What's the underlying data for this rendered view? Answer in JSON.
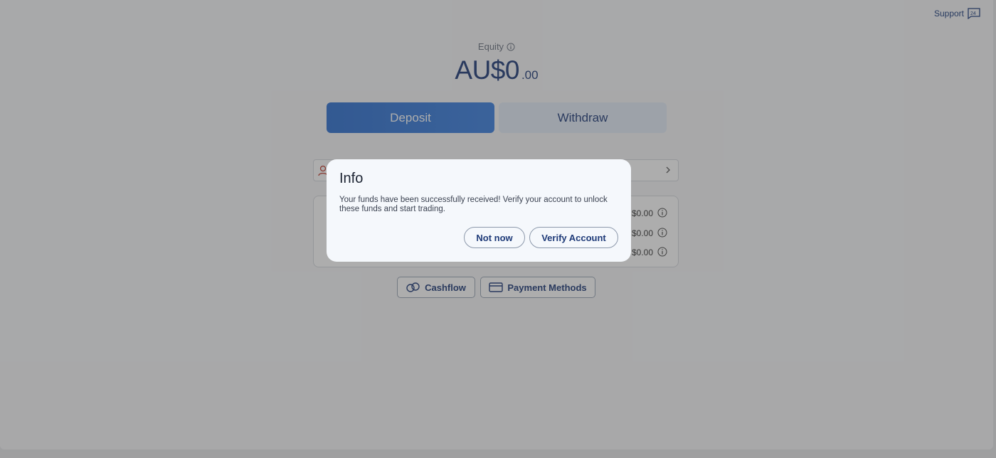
{
  "header": {
    "support_label": "Support",
    "support_icon": "chat-24-icon"
  },
  "equity": {
    "label": "Equity",
    "main": "AU$0",
    "decimals": ".00"
  },
  "actions": {
    "deposit_label": "Deposit",
    "withdraw_label": "Withdraw"
  },
  "balances": [
    {
      "value": "$0.00"
    },
    {
      "value": "$0.00"
    },
    {
      "value": "$0.00"
    }
  ],
  "bottom_buttons": {
    "cashflow_label": "Cashflow",
    "payment_label": "Payment Methods"
  },
  "dialog": {
    "title": "Info",
    "message": "Your funds have been successfully received! Verify your account to unlock these funds and start trading.",
    "not_now_label": "Not now",
    "verify_label": "Verify Account"
  },
  "colors": {
    "primary": "#2d6fd0",
    "navy": "#1e3a78",
    "accent_user_icon": "#c0392b",
    "background": "#f6f7f9"
  }
}
